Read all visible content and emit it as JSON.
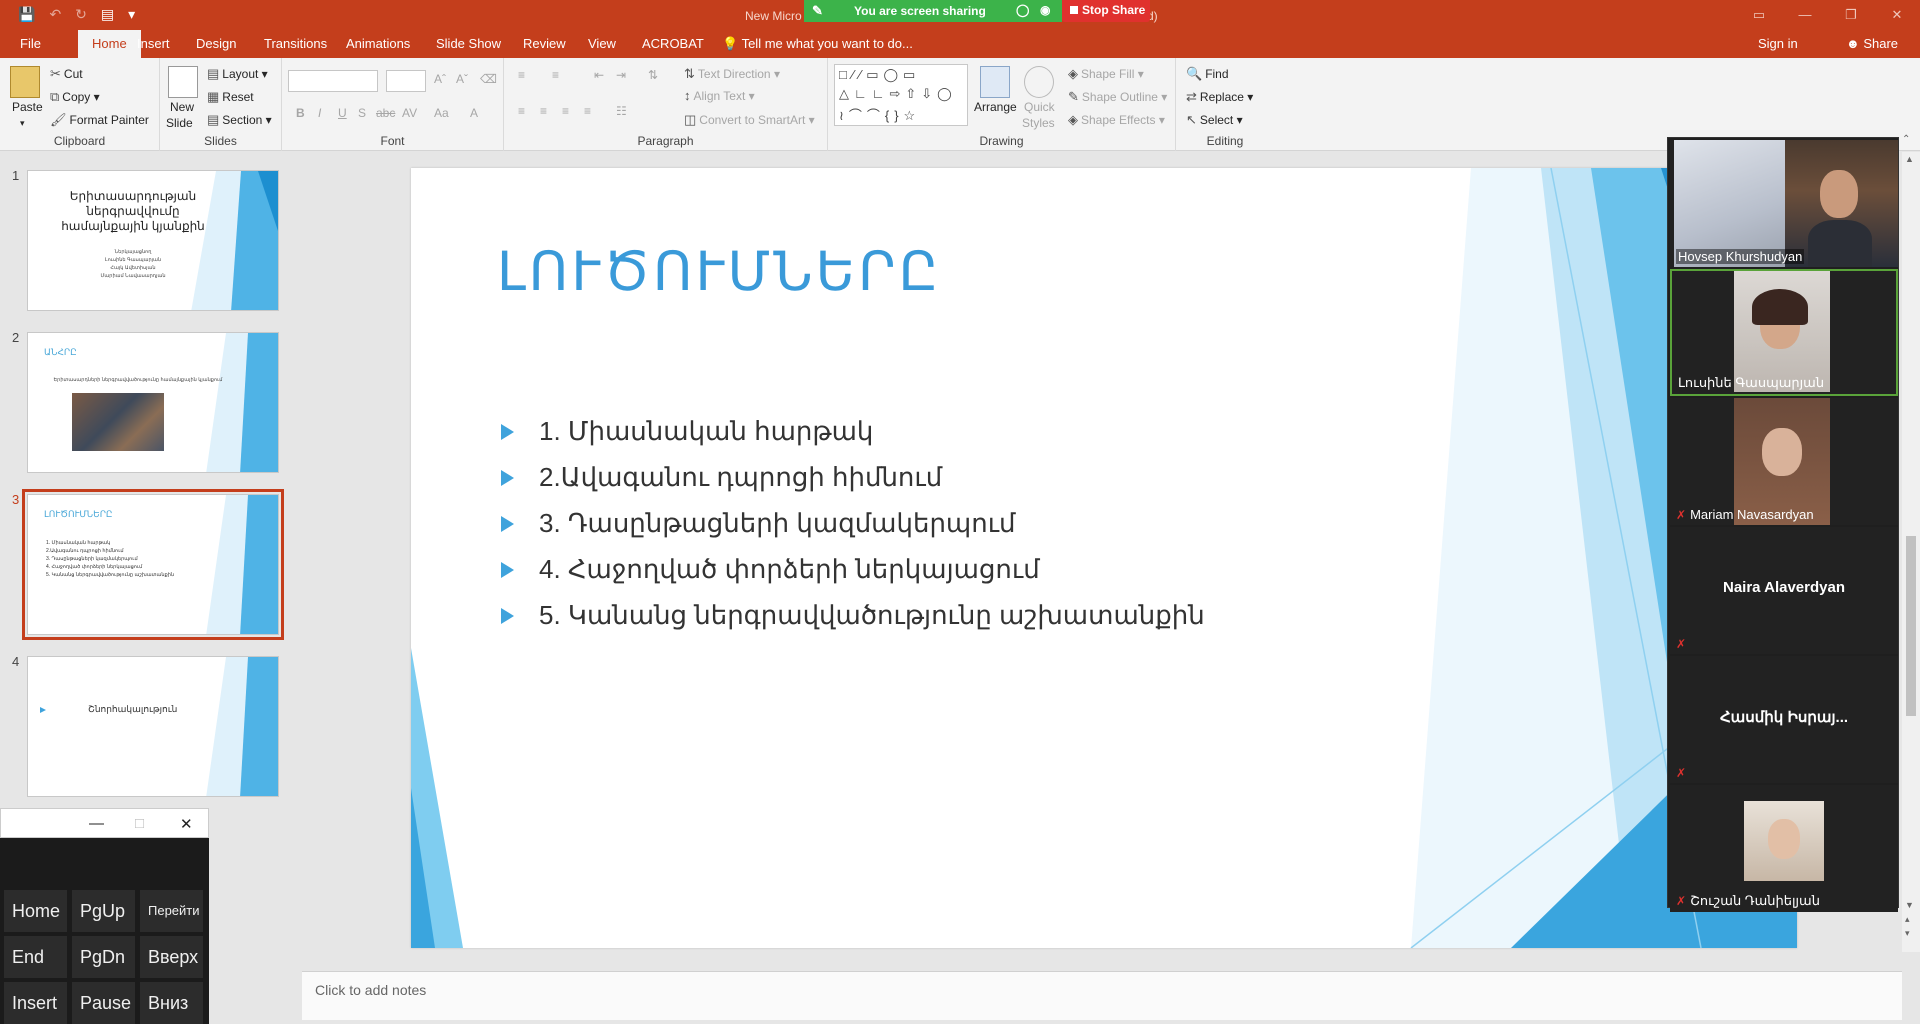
{
  "titlebar": {
    "doc_title": "New Micro",
    "doc_title_end": "iled)",
    "share_status": "You are screen sharing",
    "stop_share": "Stop Share"
  },
  "tabs": [
    "File",
    "Home",
    "Insert",
    "Design",
    "Transitions",
    "Animations",
    "Slide Show",
    "Review",
    "View",
    "ACROBAT"
  ],
  "tell_me": "Tell me what you want to do...",
  "sign_in": "Sign in",
  "share": "Share",
  "ribbon": {
    "clipboard": {
      "paste": "Paste",
      "cut": "Cut",
      "copy": "Copy",
      "format_painter": "Format Painter",
      "label": "Clipboard"
    },
    "slides": {
      "new_slide": "New",
      "new_slide2": "Slide",
      "layout": "Layout",
      "reset": "Reset",
      "section": "Section",
      "label": "Slides"
    },
    "font": {
      "label": "Font"
    },
    "paragraph": {
      "text_direction": "Text Direction",
      "align_text": "Align Text",
      "convert_smartart": "Convert to SmartArt",
      "label": "Paragraph"
    },
    "drawing": {
      "arrange": "Arrange",
      "quick_styles": "Quick",
      "quick_styles2": "Styles",
      "shape_fill": "Shape Fill",
      "shape_outline": "Shape Outline",
      "shape_effects": "Shape Effects",
      "label": "Drawing"
    },
    "editing": {
      "find": "Find",
      "replace": "Replace",
      "select": "Select",
      "label": "Editing"
    }
  },
  "thumbnails": [
    {
      "num": "1",
      "title": "Երիտասարդության ներգրավվումը համայնքային կյանքին",
      "sub": [
        "Ներկայացնող",
        "Լուսինե Գասպարյան",
        "Հայկ Ավետիսյան",
        "Մարիամ Նավասարդյան"
      ]
    },
    {
      "num": "2",
      "title": "ԱՆՀՐԸ",
      "sub": [
        "Երիտասարդների ներգրավվածությունը համայնքային կյանքում"
      ]
    },
    {
      "num": "3",
      "title": "ԼՈՒԾՈՒՄՆԵՐԸ",
      "sub": [
        "1. Միասնական հարթակ",
        "2.Ավագանու դպրոցի հիմնում",
        "3. Դասընթացների կազմակերպում",
        "4. Հաջողված փորձերի ներկայացում",
        "5. Կանանց ներգրավվածությունը աշխատանքին"
      ]
    },
    {
      "num": "4",
      "title": "Շնորհակալություն",
      "sub": []
    }
  ],
  "slide": {
    "title": "ԼՈՒԾՈՒՄՆԵՐԸ",
    "bullets": [
      "1. Միասնական հարթակ",
      "2.Ավագանու դպրոցի հիմնում",
      "3. Դասընթացների կազմակերպում",
      "4. Հաջողված փորձերի ներկայացում",
      "5. Կանանց ներգրավվածությունը աշխատանքին"
    ]
  },
  "notes_placeholder": "Click to add notes",
  "participants": [
    {
      "name": "Hovsep Khurshudyan",
      "muted": false,
      "video": true
    },
    {
      "name": "Լուսինե Գասպարյան",
      "muted": false,
      "video": true
    },
    {
      "name": "Mariam Navasardyan",
      "muted": true,
      "video": true
    },
    {
      "name": "Naira Alaverdyan",
      "muted": true,
      "video": false
    },
    {
      "name": "Հասմիկ Իսրայ...",
      "muted": true,
      "video": false
    },
    {
      "name": "Շուշան Դանիելյան",
      "muted": true,
      "video": true
    }
  ],
  "osk": {
    "keys": [
      "Home",
      "PgUp",
      "Перейти",
      "End",
      "PgDn",
      "Вверх",
      "Insert",
      "Pause",
      "Вниз"
    ]
  },
  "colors": {
    "accent": "#c43e1c",
    "slide_blue": "#3a9ad9",
    "share_green": "#3cb34a",
    "stop_red": "#e0312e"
  }
}
